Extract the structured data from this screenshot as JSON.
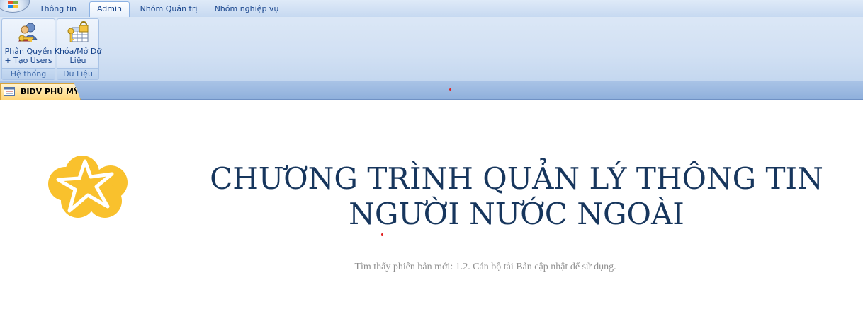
{
  "ribbon": {
    "tabs": [
      {
        "label": "Thông tin",
        "active": false
      },
      {
        "label": "Admin",
        "active": true
      },
      {
        "label": "Nhóm Quản trị",
        "active": false
      },
      {
        "label": "Nhóm nghiệp vụ",
        "active": false
      }
    ],
    "groups": [
      {
        "label": "Hệ thống",
        "buttons": [
          {
            "label": "Phân Quyền + Tạo Users",
            "icon": "users-keys-icon"
          }
        ]
      },
      {
        "label": "Dữ Liệu",
        "buttons": [
          {
            "label": "Khóa/Mở Dữ Liệu",
            "icon": "lock-grid-icon"
          }
        ]
      }
    ]
  },
  "document_tab": {
    "label": "BIDV PHÚ MỸ",
    "icon": "form-icon"
  },
  "main": {
    "title": "CHƯƠNG TRÌNH QUẢN LÝ THÔNG TIN NGƯỜI NƯỚC NGOÀI",
    "status_message": "Tìm thấy phiên bản mới: 1.2. Cán bộ tải Bản cập nhật để sử dụng."
  },
  "colors": {
    "title": "#17365d",
    "logo": "#f9c12d",
    "accent": "#15428b"
  }
}
